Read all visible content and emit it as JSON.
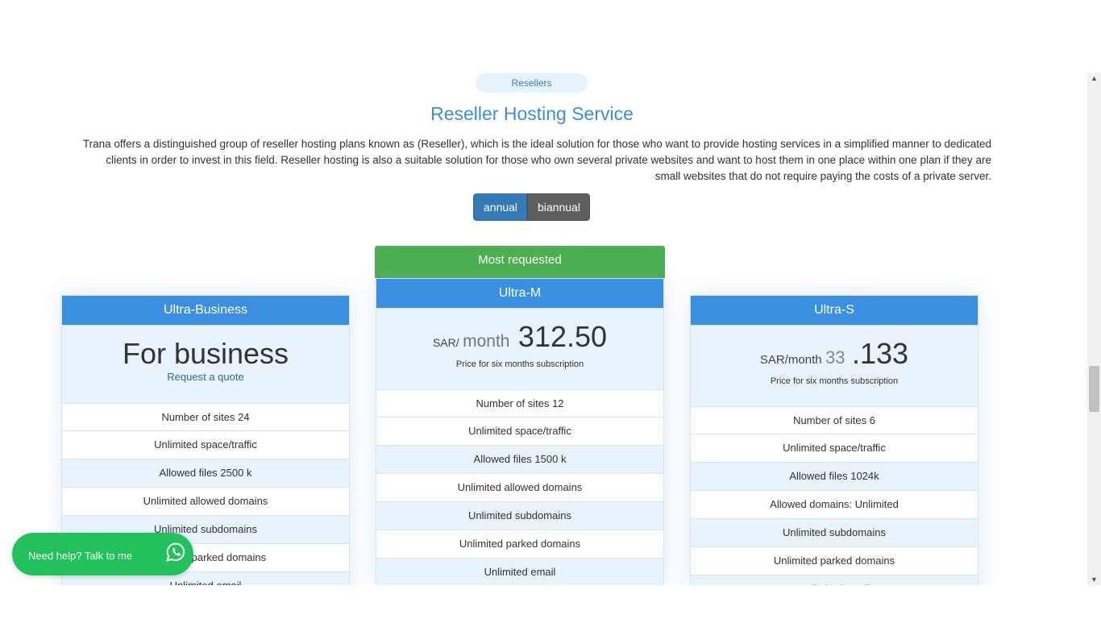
{
  "section": {
    "badge": "Resellers",
    "title": "Reseller Hosting Service",
    "description": "Trana offers a distinguished group of reseller hosting plans known as (Reseller), which is the ideal solution for those who want to provide hosting services in a simplified manner to dedicated clients in order to invest in this field. Reseller hosting is also a suitable solution for those who own several private websites and want to host them in one place within one plan if they are small websites that do not require paying the costs of a private server."
  },
  "billing_toggle": {
    "annual": "annual",
    "biannual": "biannual",
    "selected": "annual"
  },
  "plans": [
    {
      "name": "Ultra-Business",
      "headline": "For business",
      "cta": "Request a quote",
      "features": [
        "Number of sites 24",
        "Unlimited space/traffic",
        "Allowed files 2500 k",
        "Unlimited allowed domains",
        "Unlimited subdomains",
        "Unlimited parked domains",
        "Unlimited email"
      ]
    },
    {
      "name": "Ultra-M",
      "badge": "Most requested",
      "currency": "SAR/",
      "period": "month",
      "amount": "312.50",
      "note": "Price for six months subscription",
      "features": [
        "Number of sites 12",
        "Unlimited space/traffic",
        "Allowed files 1500 k",
        "Unlimited allowed domains",
        "Unlimited subdomains",
        "Unlimited parked domains",
        "Unlimited email"
      ]
    },
    {
      "name": "Ultra-S",
      "currency": "SAR/month",
      "amount_small": "33",
      "amount": ".133",
      "note": "Price for six months subscription",
      "features": [
        "Number of sites 6",
        "Unlimited space/traffic",
        "Allowed files 1024k",
        "Allowed domains: Unlimited",
        "Unlimited subdomains",
        "Unlimited parked domains",
        "Unlimited email"
      ]
    }
  ],
  "help_widget": {
    "label": "Need help? Talk to me",
    "icon": "whatsapp-icon",
    "color": "#23c15b"
  },
  "colors": {
    "accent": "#3b8fe0",
    "badge_green": "#4caf50",
    "toggle_active": "#337ab7"
  }
}
